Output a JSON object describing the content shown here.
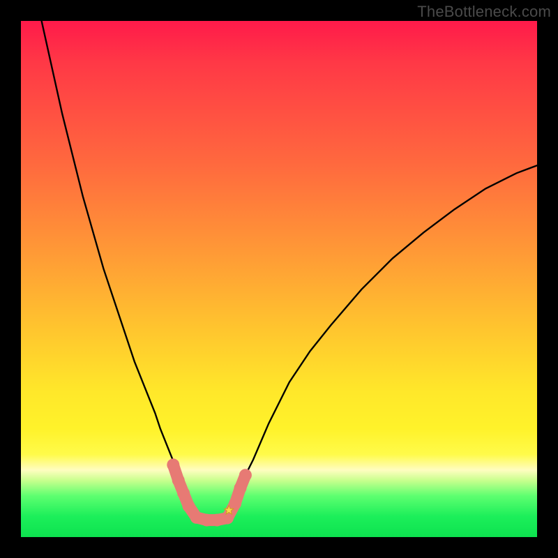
{
  "watermark": "TheBottleneck.com",
  "chart_data": {
    "type": "line",
    "title": "",
    "xlabel": "",
    "ylabel": "",
    "xlim": [
      0,
      100
    ],
    "ylim": [
      0,
      100
    ],
    "note": "Axes are unlabeled in the source image; values are normalized 0–100 estimates read from pixel positions.",
    "series": [
      {
        "name": "left-branch",
        "x": [
          4,
          6,
          8,
          10,
          12,
          14,
          16,
          18,
          20,
          22,
          24,
          26,
          27,
          28,
          29,
          30,
          31,
          32,
          33,
          34
        ],
        "y": [
          100,
          91,
          82,
          74,
          66,
          59,
          52,
          46,
          40,
          34,
          29,
          24,
          21,
          18.5,
          16,
          13.5,
          11,
          8.5,
          6,
          3.5
        ]
      },
      {
        "name": "right-branch",
        "x": [
          40,
          41,
          42,
          43,
          45,
          48,
          52,
          56,
          60,
          66,
          72,
          78,
          84,
          90,
          96,
          100
        ],
        "y": [
          3.5,
          6,
          8.5,
          11,
          15,
          22,
          30,
          36,
          41,
          48,
          54,
          59,
          63.5,
          67.5,
          70.5,
          72
        ]
      },
      {
        "name": "valley-floor",
        "x": [
          34,
          36,
          38,
          40
        ],
        "y": [
          3.5,
          3.2,
          3.2,
          3.5
        ]
      }
    ],
    "markers": {
      "name": "salmon-blobs",
      "color": "#e77a74",
      "points": [
        {
          "x": 29.5,
          "y": 14
        },
        {
          "x": 30.5,
          "y": 11
        },
        {
          "x": 31.5,
          "y": 8.5
        },
        {
          "x": 32.5,
          "y": 6
        },
        {
          "x": 34,
          "y": 3.8
        },
        {
          "x": 36,
          "y": 3.3
        },
        {
          "x": 38,
          "y": 3.3
        },
        {
          "x": 40,
          "y": 3.7
        },
        {
          "x": 41.5,
          "y": 6.5
        },
        {
          "x": 42.5,
          "y": 9.5
        },
        {
          "x": 43.5,
          "y": 12
        }
      ]
    },
    "star": {
      "x": 40.3,
      "y": 5.2,
      "color": "#ffd24a"
    }
  }
}
